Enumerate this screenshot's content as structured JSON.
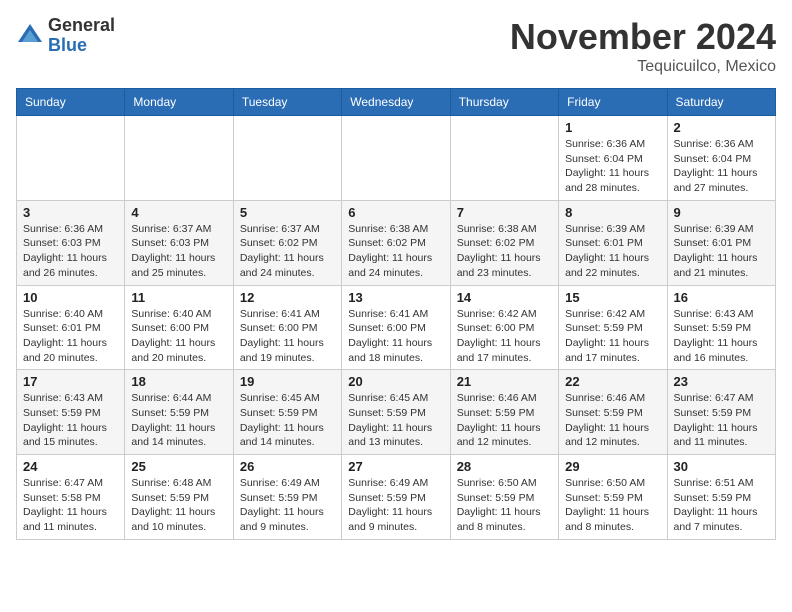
{
  "logo": {
    "general": "General",
    "blue": "Blue"
  },
  "header": {
    "month": "November 2024",
    "location": "Tequicuilco, Mexico"
  },
  "weekdays": [
    "Sunday",
    "Monday",
    "Tuesday",
    "Wednesday",
    "Thursday",
    "Friday",
    "Saturday"
  ],
  "weeks": [
    [
      {
        "day": "",
        "info": ""
      },
      {
        "day": "",
        "info": ""
      },
      {
        "day": "",
        "info": ""
      },
      {
        "day": "",
        "info": ""
      },
      {
        "day": "",
        "info": ""
      },
      {
        "day": "1",
        "info": "Sunrise: 6:36 AM\nSunset: 6:04 PM\nDaylight: 11 hours\nand 28 minutes."
      },
      {
        "day": "2",
        "info": "Sunrise: 6:36 AM\nSunset: 6:04 PM\nDaylight: 11 hours\nand 27 minutes."
      }
    ],
    [
      {
        "day": "3",
        "info": "Sunrise: 6:36 AM\nSunset: 6:03 PM\nDaylight: 11 hours\nand 26 minutes."
      },
      {
        "day": "4",
        "info": "Sunrise: 6:37 AM\nSunset: 6:03 PM\nDaylight: 11 hours\nand 25 minutes."
      },
      {
        "day": "5",
        "info": "Sunrise: 6:37 AM\nSunset: 6:02 PM\nDaylight: 11 hours\nand 24 minutes."
      },
      {
        "day": "6",
        "info": "Sunrise: 6:38 AM\nSunset: 6:02 PM\nDaylight: 11 hours\nand 24 minutes."
      },
      {
        "day": "7",
        "info": "Sunrise: 6:38 AM\nSunset: 6:02 PM\nDaylight: 11 hours\nand 23 minutes."
      },
      {
        "day": "8",
        "info": "Sunrise: 6:39 AM\nSunset: 6:01 PM\nDaylight: 11 hours\nand 22 minutes."
      },
      {
        "day": "9",
        "info": "Sunrise: 6:39 AM\nSunset: 6:01 PM\nDaylight: 11 hours\nand 21 minutes."
      }
    ],
    [
      {
        "day": "10",
        "info": "Sunrise: 6:40 AM\nSunset: 6:01 PM\nDaylight: 11 hours\nand 20 minutes."
      },
      {
        "day": "11",
        "info": "Sunrise: 6:40 AM\nSunset: 6:00 PM\nDaylight: 11 hours\nand 20 minutes."
      },
      {
        "day": "12",
        "info": "Sunrise: 6:41 AM\nSunset: 6:00 PM\nDaylight: 11 hours\nand 19 minutes."
      },
      {
        "day": "13",
        "info": "Sunrise: 6:41 AM\nSunset: 6:00 PM\nDaylight: 11 hours\nand 18 minutes."
      },
      {
        "day": "14",
        "info": "Sunrise: 6:42 AM\nSunset: 6:00 PM\nDaylight: 11 hours\nand 17 minutes."
      },
      {
        "day": "15",
        "info": "Sunrise: 6:42 AM\nSunset: 5:59 PM\nDaylight: 11 hours\nand 17 minutes."
      },
      {
        "day": "16",
        "info": "Sunrise: 6:43 AM\nSunset: 5:59 PM\nDaylight: 11 hours\nand 16 minutes."
      }
    ],
    [
      {
        "day": "17",
        "info": "Sunrise: 6:43 AM\nSunset: 5:59 PM\nDaylight: 11 hours\nand 15 minutes."
      },
      {
        "day": "18",
        "info": "Sunrise: 6:44 AM\nSunset: 5:59 PM\nDaylight: 11 hours\nand 14 minutes."
      },
      {
        "day": "19",
        "info": "Sunrise: 6:45 AM\nSunset: 5:59 PM\nDaylight: 11 hours\nand 14 minutes."
      },
      {
        "day": "20",
        "info": "Sunrise: 6:45 AM\nSunset: 5:59 PM\nDaylight: 11 hours\nand 13 minutes."
      },
      {
        "day": "21",
        "info": "Sunrise: 6:46 AM\nSunset: 5:59 PM\nDaylight: 11 hours\nand 12 minutes."
      },
      {
        "day": "22",
        "info": "Sunrise: 6:46 AM\nSunset: 5:59 PM\nDaylight: 11 hours\nand 12 minutes."
      },
      {
        "day": "23",
        "info": "Sunrise: 6:47 AM\nSunset: 5:59 PM\nDaylight: 11 hours\nand 11 minutes."
      }
    ],
    [
      {
        "day": "24",
        "info": "Sunrise: 6:47 AM\nSunset: 5:58 PM\nDaylight: 11 hours\nand 11 minutes."
      },
      {
        "day": "25",
        "info": "Sunrise: 6:48 AM\nSunset: 5:59 PM\nDaylight: 11 hours\nand 10 minutes."
      },
      {
        "day": "26",
        "info": "Sunrise: 6:49 AM\nSunset: 5:59 PM\nDaylight: 11 hours\nand 9 minutes."
      },
      {
        "day": "27",
        "info": "Sunrise: 6:49 AM\nSunset: 5:59 PM\nDaylight: 11 hours\nand 9 minutes."
      },
      {
        "day": "28",
        "info": "Sunrise: 6:50 AM\nSunset: 5:59 PM\nDaylight: 11 hours\nand 8 minutes."
      },
      {
        "day": "29",
        "info": "Sunrise: 6:50 AM\nSunset: 5:59 PM\nDaylight: 11 hours\nand 8 minutes."
      },
      {
        "day": "30",
        "info": "Sunrise: 6:51 AM\nSunset: 5:59 PM\nDaylight: 11 hours\nand 7 minutes."
      }
    ]
  ]
}
